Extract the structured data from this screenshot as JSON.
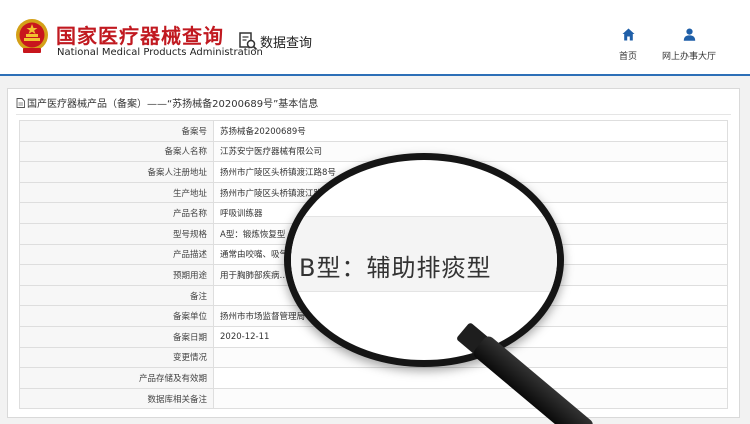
{
  "header": {
    "brand_cn": "国家医疗器械查询",
    "brand_en": "National Medical Products Administration",
    "data_query_label": "数据查询",
    "nav": {
      "home_label": "首页",
      "office_label": "网上办事大厅"
    }
  },
  "panel": {
    "title": "国产医疗器械产品（备案）——“苏扬械备20200689号”基本信息"
  },
  "record_rows": [
    {
      "label": "备案号",
      "value": "苏扬械备20200689号"
    },
    {
      "label": "备案人名称",
      "value": "江苏安宁医疗器械有限公司"
    },
    {
      "label": "备案人注册地址",
      "value": "扬州市广陵区头桥镇渡江路8号"
    },
    {
      "label": "生产地址",
      "value": "扬州市广陵区头桥镇渡江路8号"
    },
    {
      "label": "产品名称",
      "value": "呼吸训练器"
    },
    {
      "label": "型号规格",
      "value": "A型：锻炼恢复型"
    },
    {
      "label": "产品描述",
      "value": "通常由咬嘴、吸气……的装置。"
    },
    {
      "label": "预期用途",
      "value": "用于胸肺部疾病……；减少和预防术后肺部并发症。"
    },
    {
      "label": "备注",
      "value": ""
    },
    {
      "label": "备案单位",
      "value": "扬州市市场监督管理局"
    },
    {
      "label": "备案日期",
      "value": "2020-12-11"
    },
    {
      "label": "变更情况",
      "value": ""
    },
    {
      "label": "产品存储及有效期",
      "value": ""
    },
    {
      "label": "数据库相关备注",
      "value": ""
    }
  ],
  "magnifier": {
    "text": "B型：辅助排痰型"
  },
  "colors": {
    "brand_red": "#c11920",
    "nav_blue": "#1f5fa8",
    "header_rule": "#2d6fb7"
  },
  "icons": {
    "logo": "national-emblem-icon",
    "data_query": "document-search-icon",
    "home": "home-icon",
    "office": "user-icon",
    "panel_title": "document-icon"
  }
}
